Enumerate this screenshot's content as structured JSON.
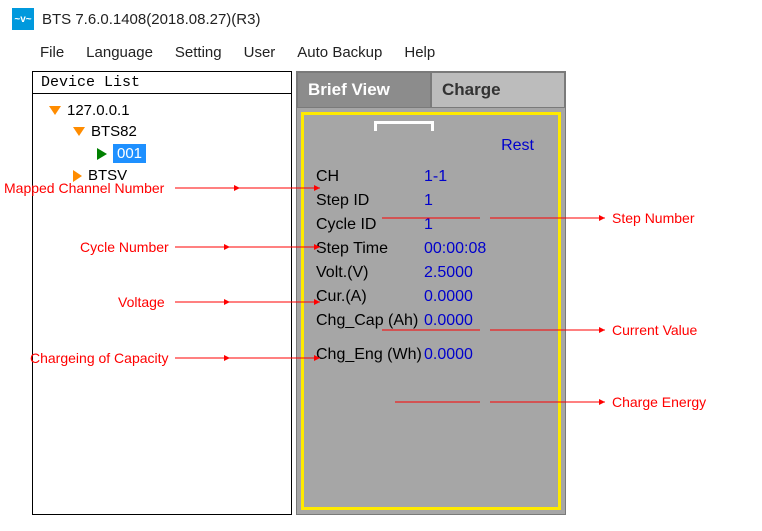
{
  "window": {
    "icon_text": "~v~",
    "title": "BTS 7.6.0.1408(2018.08.27)(R3)"
  },
  "menu": {
    "file": "File",
    "language": "Language",
    "setting": "Setting",
    "user": "User",
    "auto_backup": "Auto Backup",
    "help": "Help"
  },
  "tree": {
    "header": "Device List",
    "root": "127.0.0.1",
    "dev1": "BTS82",
    "chan": "001",
    "dev2": "BTSV"
  },
  "tabs": {
    "brief": "Brief View",
    "charge": "Charge"
  },
  "brief": {
    "status": "Rest",
    "rows": {
      "ch_k": "CH",
      "ch_v": "1-1",
      "stepid_k": "Step ID",
      "stepid_v": "1",
      "cycleid_k": "Cycle ID",
      "cycleid_v": "1",
      "steptime_k": "Step Time",
      "steptime_v": "00:00:08",
      "volt_k": "Volt.(V)",
      "volt_v": "2.5000",
      "cur_k": "Cur.(A)",
      "cur_v": "0.0000",
      "chgcap_k": "Chg_Cap (Ah)",
      "chgcap_v": "0.0000",
      "chgeng_k": "Chg_Eng (Wh)",
      "chgeng_v": "0.0000"
    }
  },
  "annotations": {
    "mapped_channel": "Mapped Channel Number",
    "cycle_number": "Cycle Number",
    "voltage": "Voltage",
    "charging_capacity": "Chargeing of Capacity",
    "step_number": "Step Number",
    "current_value": "Current Value",
    "charge_energy": "Charge Energy"
  }
}
